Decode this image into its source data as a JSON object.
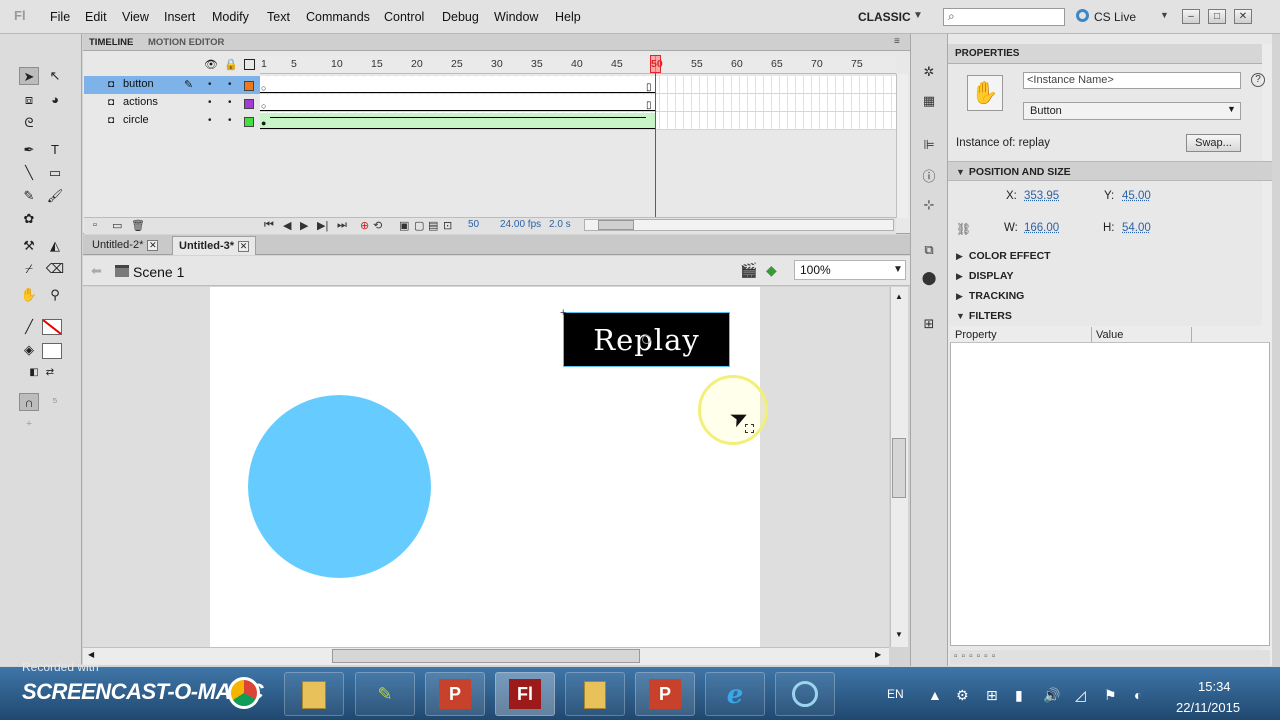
{
  "menubar": {
    "logo": "Fl",
    "items": [
      "File",
      "Edit",
      "View",
      "Insert",
      "Modify",
      "Text",
      "Commands",
      "Control",
      "Debug",
      "Window",
      "Help"
    ],
    "workspace": "CLASSIC",
    "cs_live": "CS Live"
  },
  "timeline": {
    "tabs": [
      "TIMELINE",
      "MOTION EDITOR"
    ],
    "ruler": [
      "1",
      "5",
      "10",
      "15",
      "20",
      "25",
      "30",
      "35",
      "40",
      "45",
      "50",
      "55",
      "60",
      "65",
      "70",
      "75"
    ],
    "layers": [
      {
        "name": "button",
        "color": "#f07818"
      },
      {
        "name": "actions",
        "color": "#a23cd8"
      },
      {
        "name": "circle",
        "color": "#44dd44"
      }
    ],
    "current_frame": "50",
    "fps": "24.00 fps",
    "elapsed": "2.0 s"
  },
  "documents": {
    "tabs": [
      "Untitled-2*",
      "Untitled-3*"
    ],
    "active": "Untitled-3*"
  },
  "scene": {
    "label": "Scene 1",
    "zoom": "100%"
  },
  "stage": {
    "button_label": "Replay",
    "circle_color": "#66ccff",
    "button_color": "#000000"
  },
  "properties": {
    "tab": "PROPERTIES",
    "instance_name_placeholder": "<Instance Name>",
    "symbol_type": "Button",
    "instance_of_label": "Instance of:",
    "instance_of_value": "replay",
    "swap_label": "Swap...",
    "sections": {
      "position_size": "POSITION AND SIZE",
      "color_effect": "COLOR EFFECT",
      "display": "DISPLAY",
      "tracking": "TRACKING",
      "filters": "FILTERS"
    },
    "x_label": "X:",
    "x_value": "353.95",
    "y_label": "Y:",
    "y_value": "45.00",
    "w_label": "W:",
    "w_value": "166.00",
    "h_label": "H:",
    "h_value": "54.00",
    "filters_columns": [
      "Property",
      "Value"
    ]
  },
  "taskbar": {
    "recorded_with": "Recorded with",
    "recorder_logo": "SCREENCAST-O-MATIC",
    "language": "EN",
    "time": "15:34",
    "date": "22/11/2015",
    "apps": [
      "P",
      "Fl",
      "P"
    ]
  }
}
